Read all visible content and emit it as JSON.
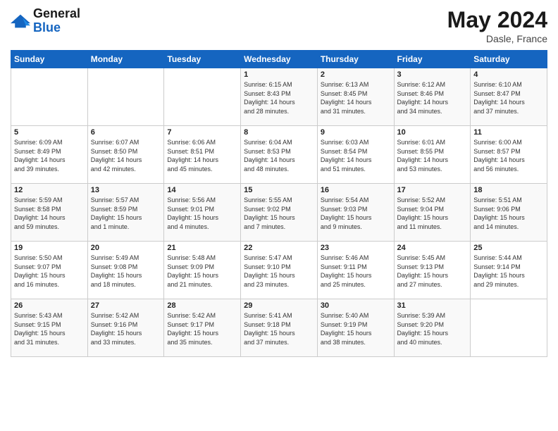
{
  "logo": {
    "general": "General",
    "blue": "Blue"
  },
  "header": {
    "title": "May 2024",
    "subtitle": "Dasle, France"
  },
  "weekdays": [
    "Sunday",
    "Monday",
    "Tuesday",
    "Wednesday",
    "Thursday",
    "Friday",
    "Saturday"
  ],
  "weeks": [
    [
      {
        "day": "",
        "info": ""
      },
      {
        "day": "",
        "info": ""
      },
      {
        "day": "",
        "info": ""
      },
      {
        "day": "1",
        "info": "Sunrise: 6:15 AM\nSunset: 8:43 PM\nDaylight: 14 hours\nand 28 minutes."
      },
      {
        "day": "2",
        "info": "Sunrise: 6:13 AM\nSunset: 8:45 PM\nDaylight: 14 hours\nand 31 minutes."
      },
      {
        "day": "3",
        "info": "Sunrise: 6:12 AM\nSunset: 8:46 PM\nDaylight: 14 hours\nand 34 minutes."
      },
      {
        "day": "4",
        "info": "Sunrise: 6:10 AM\nSunset: 8:47 PM\nDaylight: 14 hours\nand 37 minutes."
      }
    ],
    [
      {
        "day": "5",
        "info": "Sunrise: 6:09 AM\nSunset: 8:49 PM\nDaylight: 14 hours\nand 39 minutes."
      },
      {
        "day": "6",
        "info": "Sunrise: 6:07 AM\nSunset: 8:50 PM\nDaylight: 14 hours\nand 42 minutes."
      },
      {
        "day": "7",
        "info": "Sunrise: 6:06 AM\nSunset: 8:51 PM\nDaylight: 14 hours\nand 45 minutes."
      },
      {
        "day": "8",
        "info": "Sunrise: 6:04 AM\nSunset: 8:53 PM\nDaylight: 14 hours\nand 48 minutes."
      },
      {
        "day": "9",
        "info": "Sunrise: 6:03 AM\nSunset: 8:54 PM\nDaylight: 14 hours\nand 51 minutes."
      },
      {
        "day": "10",
        "info": "Sunrise: 6:01 AM\nSunset: 8:55 PM\nDaylight: 14 hours\nand 53 minutes."
      },
      {
        "day": "11",
        "info": "Sunrise: 6:00 AM\nSunset: 8:57 PM\nDaylight: 14 hours\nand 56 minutes."
      }
    ],
    [
      {
        "day": "12",
        "info": "Sunrise: 5:59 AM\nSunset: 8:58 PM\nDaylight: 14 hours\nand 59 minutes."
      },
      {
        "day": "13",
        "info": "Sunrise: 5:57 AM\nSunset: 8:59 PM\nDaylight: 15 hours\nand 1 minute."
      },
      {
        "day": "14",
        "info": "Sunrise: 5:56 AM\nSunset: 9:01 PM\nDaylight: 15 hours\nand 4 minutes."
      },
      {
        "day": "15",
        "info": "Sunrise: 5:55 AM\nSunset: 9:02 PM\nDaylight: 15 hours\nand 7 minutes."
      },
      {
        "day": "16",
        "info": "Sunrise: 5:54 AM\nSunset: 9:03 PM\nDaylight: 15 hours\nand 9 minutes."
      },
      {
        "day": "17",
        "info": "Sunrise: 5:52 AM\nSunset: 9:04 PM\nDaylight: 15 hours\nand 11 minutes."
      },
      {
        "day": "18",
        "info": "Sunrise: 5:51 AM\nSunset: 9:06 PM\nDaylight: 15 hours\nand 14 minutes."
      }
    ],
    [
      {
        "day": "19",
        "info": "Sunrise: 5:50 AM\nSunset: 9:07 PM\nDaylight: 15 hours\nand 16 minutes."
      },
      {
        "day": "20",
        "info": "Sunrise: 5:49 AM\nSunset: 9:08 PM\nDaylight: 15 hours\nand 18 minutes."
      },
      {
        "day": "21",
        "info": "Sunrise: 5:48 AM\nSunset: 9:09 PM\nDaylight: 15 hours\nand 21 minutes."
      },
      {
        "day": "22",
        "info": "Sunrise: 5:47 AM\nSunset: 9:10 PM\nDaylight: 15 hours\nand 23 minutes."
      },
      {
        "day": "23",
        "info": "Sunrise: 5:46 AM\nSunset: 9:11 PM\nDaylight: 15 hours\nand 25 minutes."
      },
      {
        "day": "24",
        "info": "Sunrise: 5:45 AM\nSunset: 9:13 PM\nDaylight: 15 hours\nand 27 minutes."
      },
      {
        "day": "25",
        "info": "Sunrise: 5:44 AM\nSunset: 9:14 PM\nDaylight: 15 hours\nand 29 minutes."
      }
    ],
    [
      {
        "day": "26",
        "info": "Sunrise: 5:43 AM\nSunset: 9:15 PM\nDaylight: 15 hours\nand 31 minutes."
      },
      {
        "day": "27",
        "info": "Sunrise: 5:42 AM\nSunset: 9:16 PM\nDaylight: 15 hours\nand 33 minutes."
      },
      {
        "day": "28",
        "info": "Sunrise: 5:42 AM\nSunset: 9:17 PM\nDaylight: 15 hours\nand 35 minutes."
      },
      {
        "day": "29",
        "info": "Sunrise: 5:41 AM\nSunset: 9:18 PM\nDaylight: 15 hours\nand 37 minutes."
      },
      {
        "day": "30",
        "info": "Sunrise: 5:40 AM\nSunset: 9:19 PM\nDaylight: 15 hours\nand 38 minutes."
      },
      {
        "day": "31",
        "info": "Sunrise: 5:39 AM\nSunset: 9:20 PM\nDaylight: 15 hours\nand 40 minutes."
      },
      {
        "day": "",
        "info": ""
      }
    ]
  ]
}
